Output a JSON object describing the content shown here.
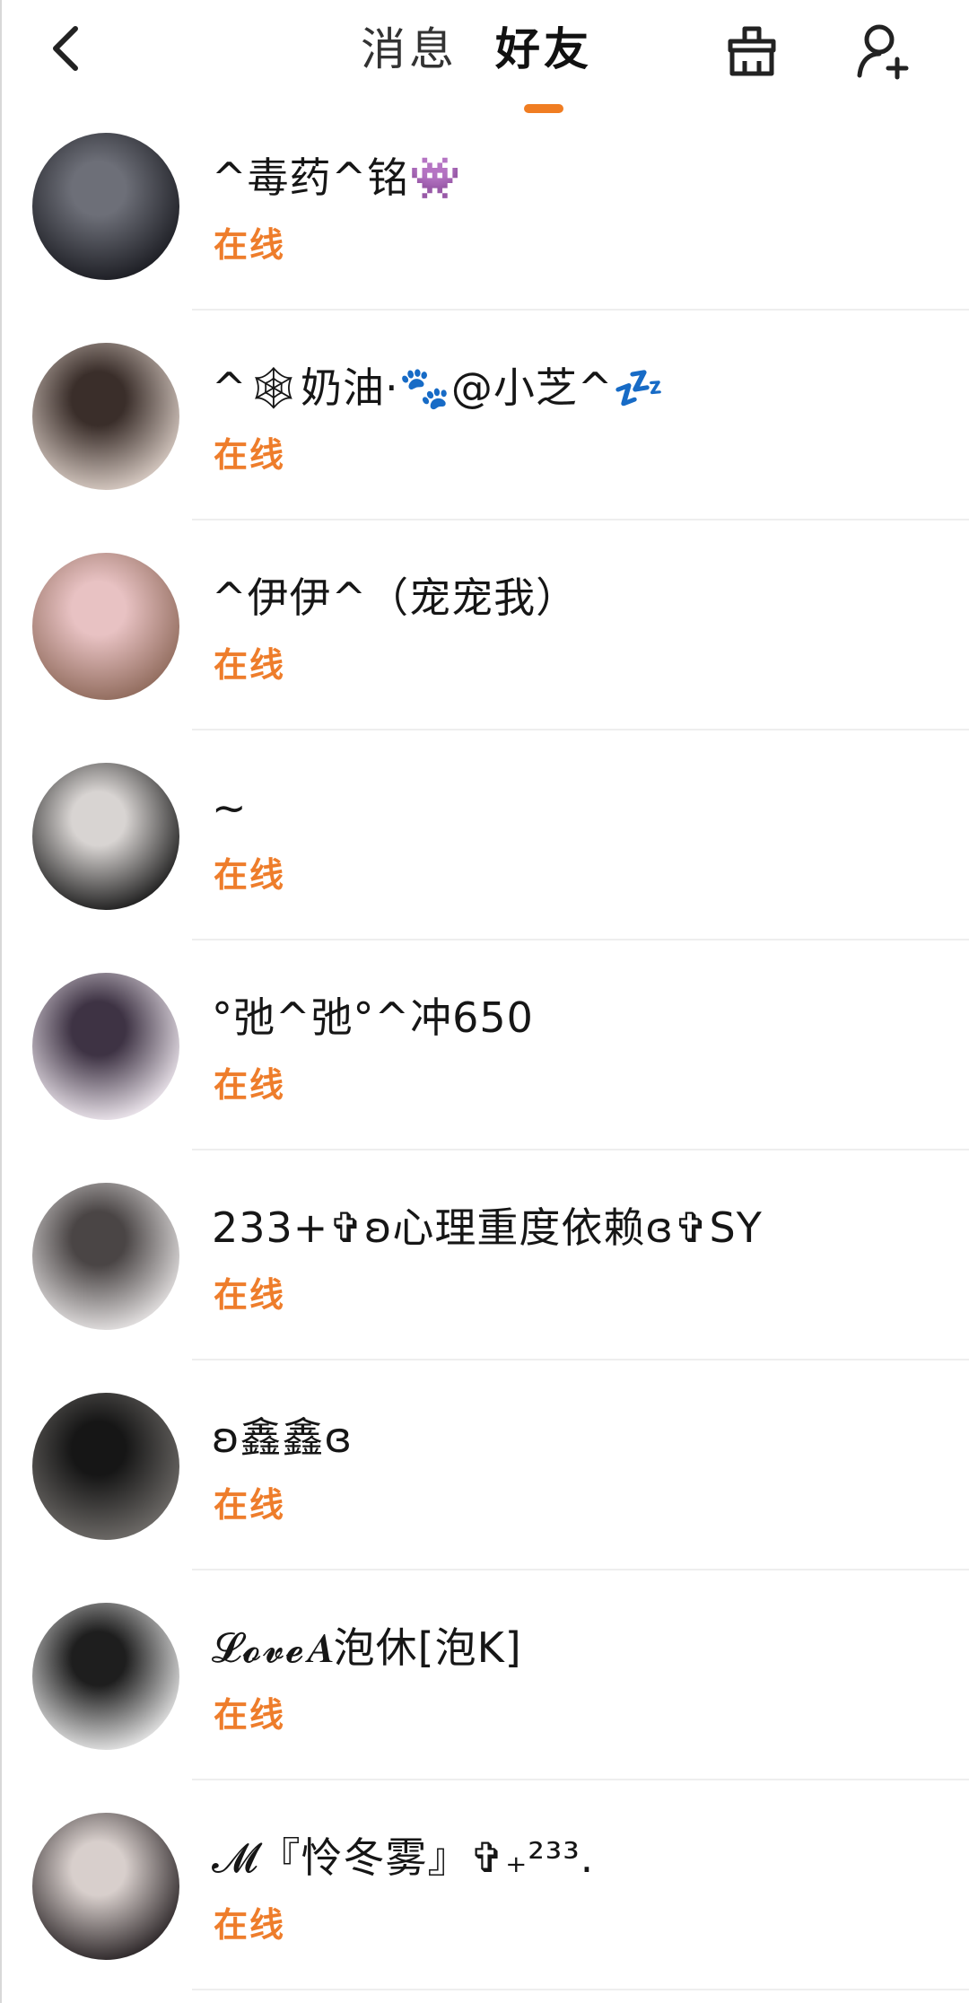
{
  "header": {
    "tabs": [
      {
        "label": "消息",
        "active": false
      },
      {
        "label": "好友",
        "active": true
      }
    ],
    "accent_color": "#f07d22",
    "icons": {
      "back": "back-arrow-icon",
      "clean": "broom-icon",
      "add_friend": "add-friend-icon"
    }
  },
  "friends": [
    {
      "name": "^毒药^铭👾",
      "status": "在线",
      "avatar_colors": [
        "#1b1c22",
        "#6d6f78"
      ]
    },
    {
      "name": "^🕸奶油·🐾@小芝^💤",
      "status": "在线",
      "avatar_colors": [
        "#d9ccc4",
        "#3a2e2a"
      ]
    },
    {
      "name": "^伊伊^（宠宠我）",
      "status": "在线",
      "avatar_colors": [
        "#8f6a5b",
        "#e8c2c3"
      ]
    },
    {
      "name": "~",
      "status": "在线",
      "avatar_colors": [
        "#1c1c1c",
        "#d8d4d2"
      ]
    },
    {
      "name": "°弛^弛°^冲650",
      "status": "在线",
      "avatar_colors": [
        "#efe8ef",
        "#3e3344"
      ]
    },
    {
      "name": "233+✞ʚ心理重度依赖ɞ✞SY",
      "status": "在线",
      "avatar_colors": [
        "#e6e3e3",
        "#4a4545"
      ]
    },
    {
      "name": "ʚ鑫鑫ɞ",
      "status": "在线",
      "avatar_colors": [
        "#6f6c69",
        "#161616"
      ]
    },
    {
      "name": "𝓛𝓸𝓿𝓮𝑨泡休[泡K]",
      "status": "在线",
      "avatar_colors": [
        "#e7e7e7",
        "#1e1e1e"
      ]
    },
    {
      "name": "𝓜『怜冬雾』✞₊²³³.",
      "status": "在线",
      "avatar_colors": [
        "#2a2426",
        "#d8cfcc"
      ]
    }
  ]
}
